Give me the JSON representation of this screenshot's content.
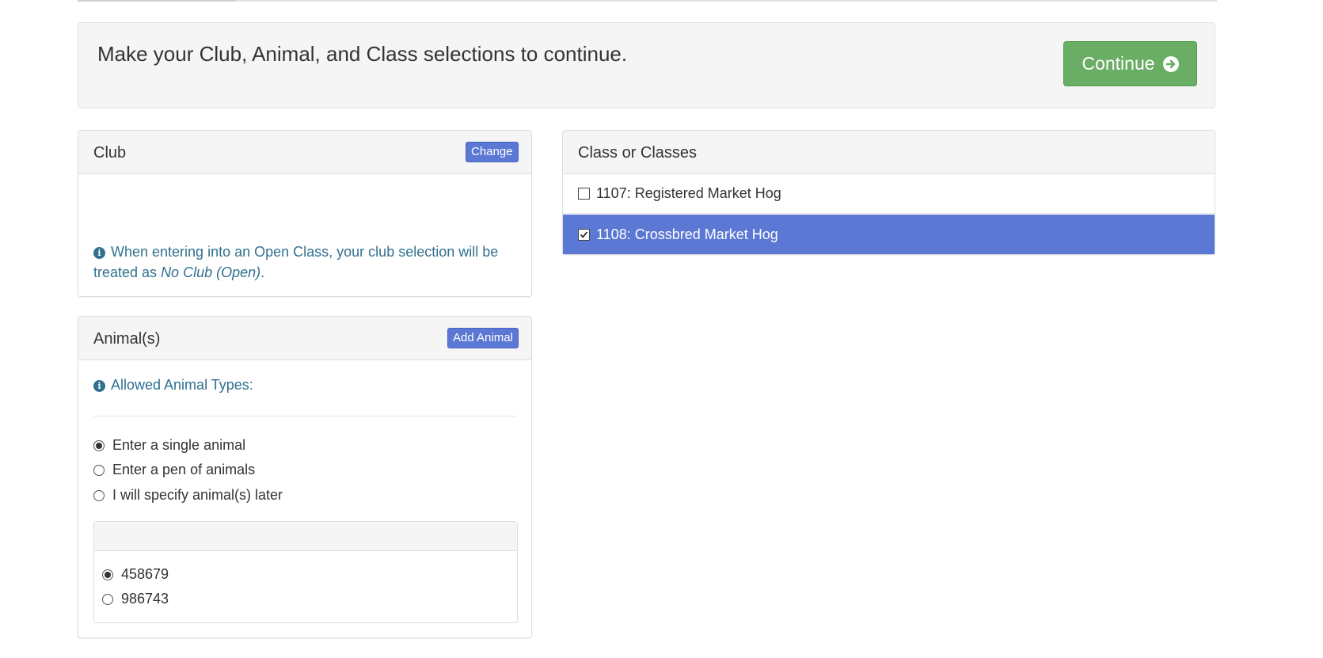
{
  "banner": {
    "message": "Make your Club, Animal, and Class selections to continue.",
    "continue_label": "Continue"
  },
  "club_panel": {
    "title": "Club",
    "change_label": "Change",
    "info_prefix": "When entering into an Open Class, your club selection will be treated as ",
    "info_emphasis": "No Club (Open)",
    "info_suffix": "."
  },
  "animal_panel": {
    "title": "Animal(s)",
    "add_label": "Add Animal",
    "allowed_types_label": "Allowed Animal Types:",
    "entry_options": [
      {
        "label": "Enter a single animal",
        "checked": true
      },
      {
        "label": "Enter a pen of animals",
        "checked": false
      },
      {
        "label": "I will specify animal(s) later",
        "checked": false
      }
    ],
    "animals": [
      {
        "label": "458679",
        "checked": true
      },
      {
        "label": "986743",
        "checked": false
      }
    ]
  },
  "class_panel": {
    "title": "Class or Classes",
    "classes": [
      {
        "label": "1107: Registered Market Hog",
        "checked": false
      },
      {
        "label": "1108: Crossbred Market Hog",
        "checked": true
      }
    ]
  },
  "colors": {
    "primary": "#5b78d4",
    "success": "#6aad64",
    "info_text": "#31708f"
  }
}
